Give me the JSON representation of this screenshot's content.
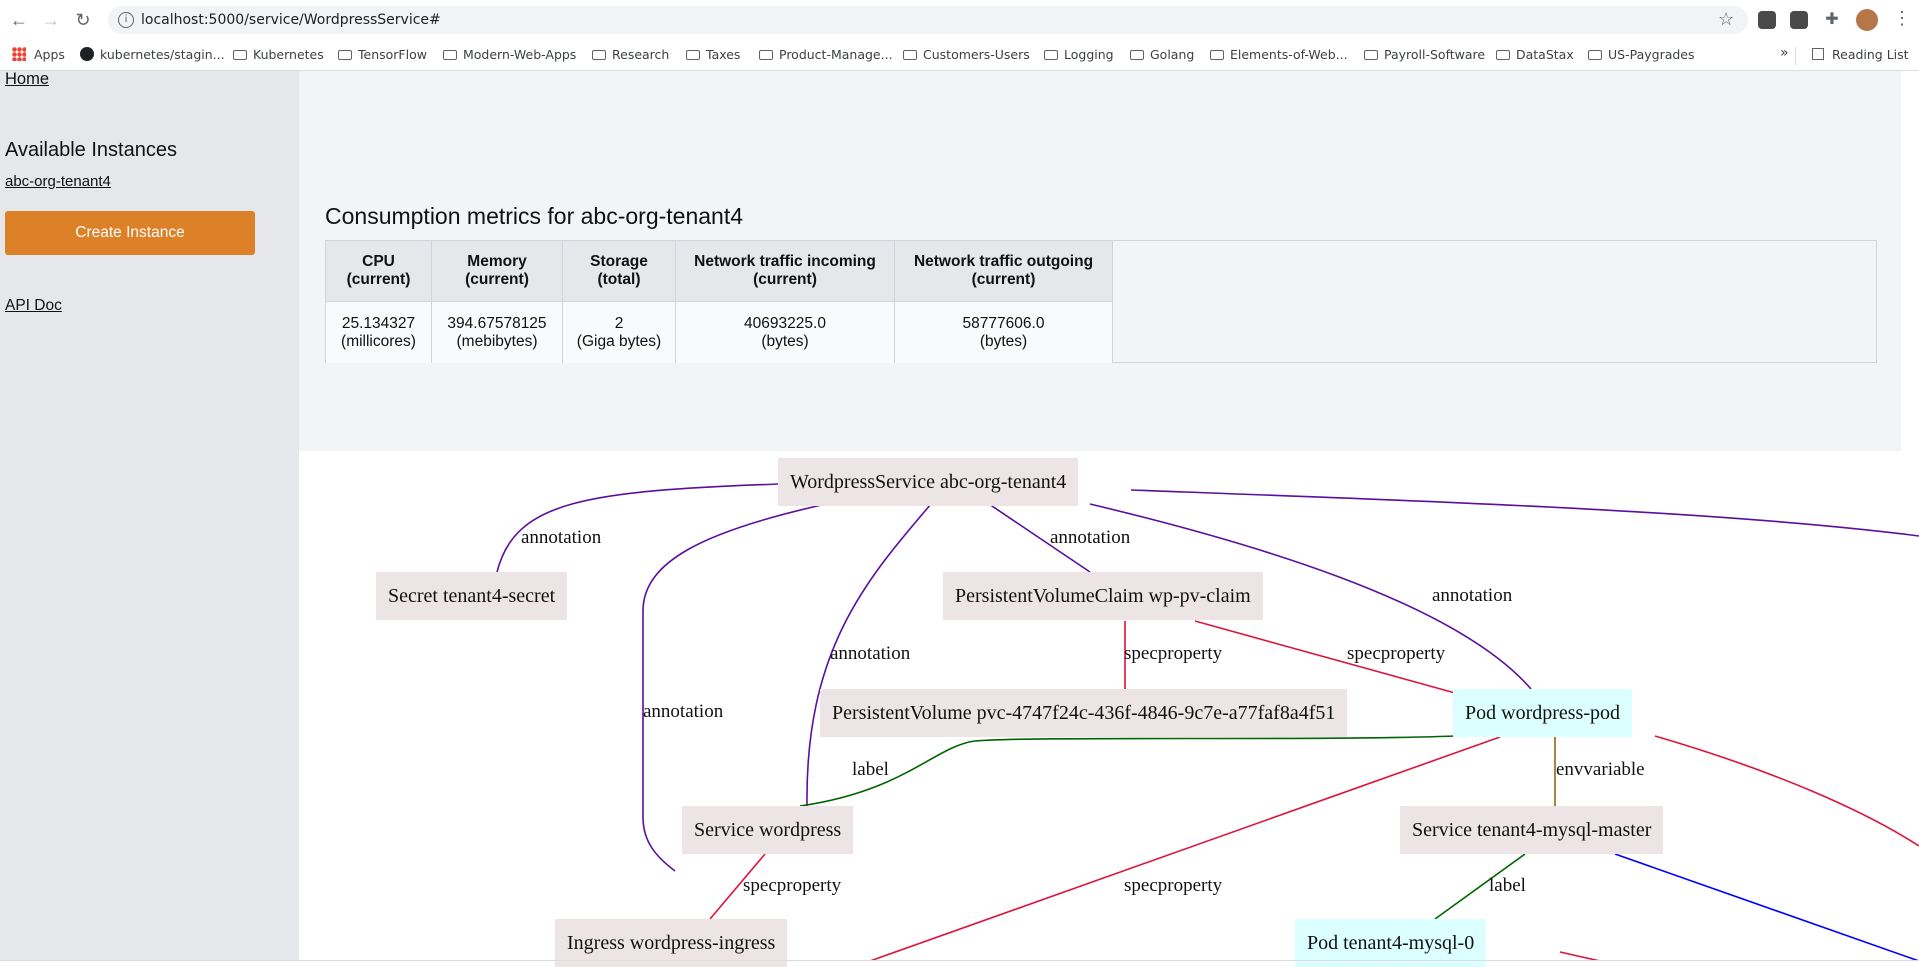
{
  "browser": {
    "url": "localhost:5000/service/WordpressService#",
    "bookmarks": [
      {
        "label": "Apps",
        "icon": "apps-grid-icon"
      },
      {
        "label": "kubernetes/stagin...",
        "icon": "github-icon"
      },
      {
        "label": "Kubernetes",
        "icon": "folder-icon"
      },
      {
        "label": "TensorFlow",
        "icon": "folder-icon"
      },
      {
        "label": "Modern-Web-Apps",
        "icon": "folder-icon"
      },
      {
        "label": "Research",
        "icon": "folder-icon"
      },
      {
        "label": "Taxes",
        "icon": "folder-icon"
      },
      {
        "label": "Product-Manage...",
        "icon": "folder-icon"
      },
      {
        "label": "Customers-Users",
        "icon": "folder-icon"
      },
      {
        "label": "Logging",
        "icon": "folder-icon"
      },
      {
        "label": "Golang",
        "icon": "folder-icon"
      },
      {
        "label": "Elements-of-Web...",
        "icon": "folder-icon"
      },
      {
        "label": "Payroll-Software",
        "icon": "folder-icon"
      },
      {
        "label": "DataStax",
        "icon": "folder-icon"
      },
      {
        "label": "US-Paygrades",
        "icon": "folder-icon"
      }
    ],
    "overflow": "»",
    "reading_list": "Reading List"
  },
  "sidebar": {
    "home": "Home",
    "available_title": "Available Instances",
    "instance": "abc-org-tenant4",
    "create_button": "Create Instance",
    "api_doc": "API Doc"
  },
  "main": {
    "title": "Consumption metrics for abc-org-tenant4",
    "headers": [
      [
        "CPU",
        "(current)"
      ],
      [
        "Memory",
        "(current)"
      ],
      [
        "Storage",
        "(total)"
      ],
      [
        "Network traffic incoming",
        "(current)"
      ],
      [
        "Network traffic outgoing",
        "(current)"
      ]
    ],
    "values": [
      [
        "25.134327",
        "(millicores)"
      ],
      [
        "394.67578125",
        "(mebibytes)"
      ],
      [
        "2",
        "(Giga bytes)"
      ],
      [
        "40693225.0",
        "(bytes)"
      ],
      [
        "58777606.0",
        "(bytes)"
      ]
    ]
  },
  "graph": {
    "nodes": {
      "wordpress_service": "WordpressService abc-org-tenant4",
      "secret": "Secret tenant4-secret",
      "pvc": "PersistentVolumeClaim wp-pv-claim",
      "pv": "PersistentVolume pvc-4747f24c-436f-4846-9c7e-a77faf8a4f51",
      "pod_wordpress": "Pod wordpress-pod",
      "service_wordpress": "Service wordpress",
      "service_mysql": "Service tenant4-mysql-master",
      "ingress": "Ingress wordpress-ingress",
      "pod_mysql": "Pod tenant4-mysql-0"
    },
    "edge_labels": {
      "annotation": "annotation",
      "specproperty": "specproperty",
      "label": "label",
      "envvariable": "envvariable"
    },
    "colors": {
      "annotation": "#5b0f9e",
      "specproperty": "#dc143c",
      "label": "#006400",
      "envvariable": "#8b6914",
      "other": "#0000ff"
    }
  }
}
